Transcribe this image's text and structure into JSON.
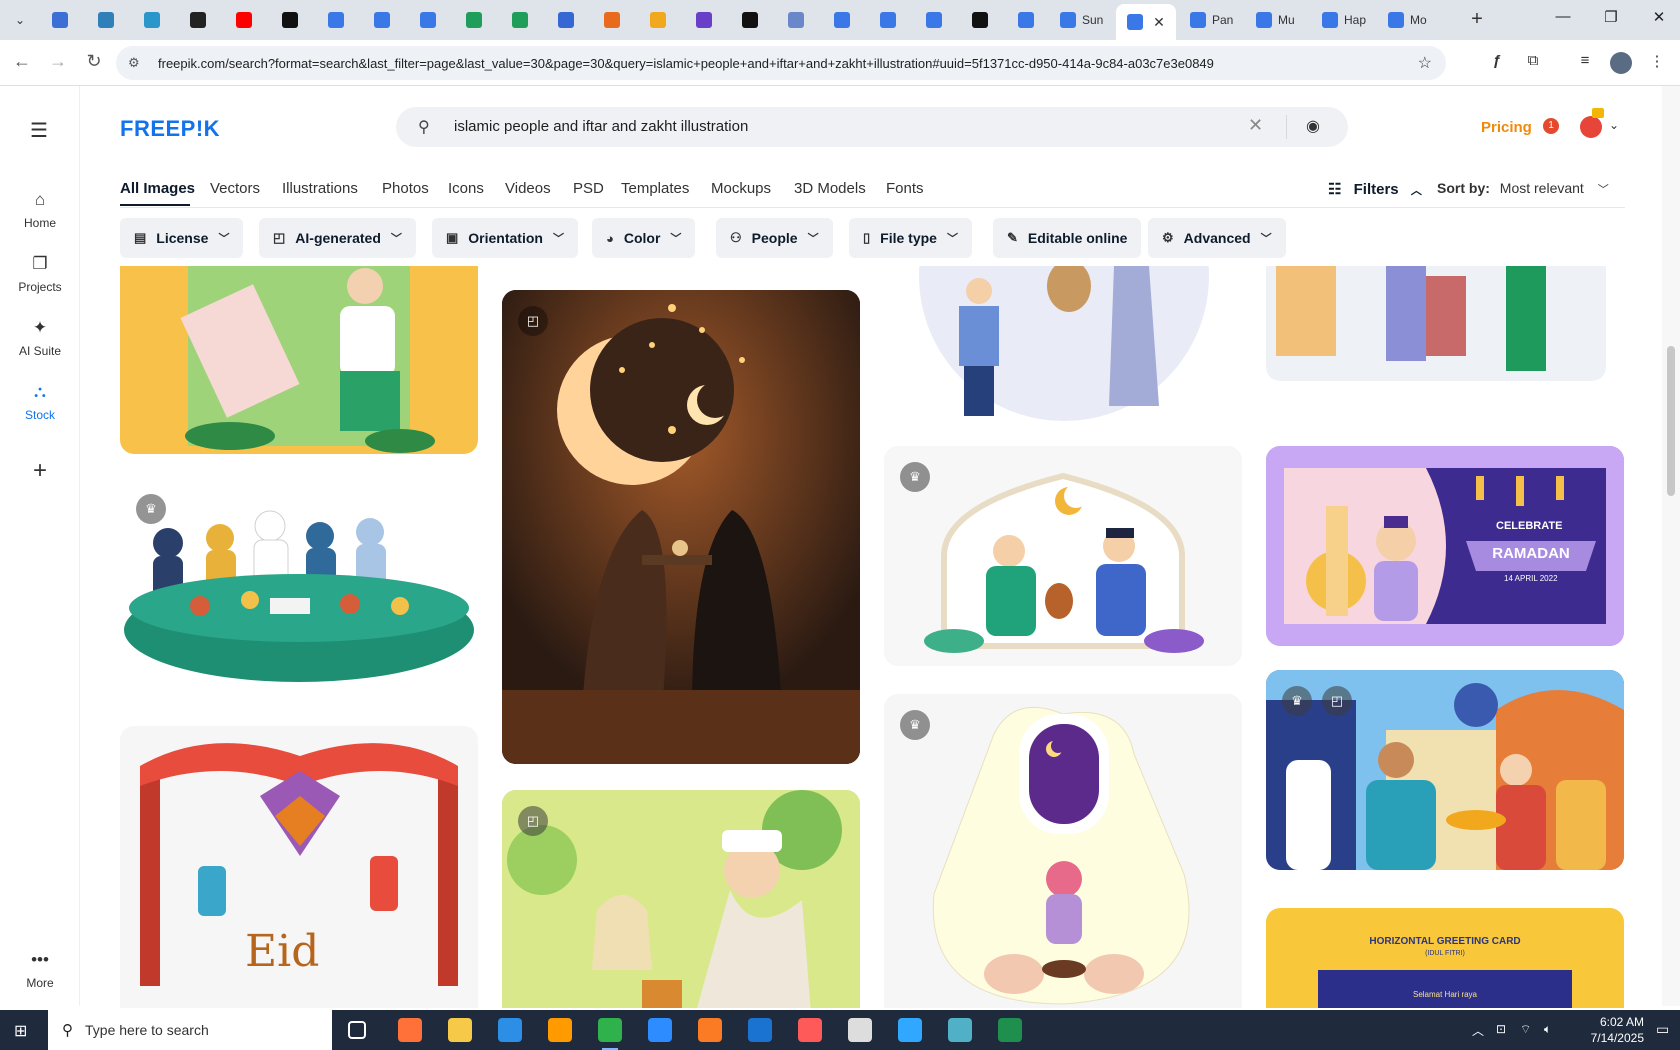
{
  "browser": {
    "tabs": [
      {
        "label": "",
        "color": "#3b6fd6"
      },
      {
        "label": "",
        "color": "#2f7fb8"
      },
      {
        "label": "",
        "color": "#2a96c9"
      },
      {
        "label": "",
        "color": "#222222"
      },
      {
        "label": "",
        "color": "#ff0000"
      },
      {
        "label": "",
        "color": "#111111"
      },
      {
        "label": "",
        "color": "#3b78e7"
      },
      {
        "label": "",
        "color": "#3b78e7"
      },
      {
        "label": "",
        "color": "#3b78e7"
      },
      {
        "label": "",
        "color": "#1e9e5a"
      },
      {
        "label": "",
        "color": "#1e9e5a"
      },
      {
        "label": "",
        "color": "#3568d4"
      },
      {
        "label": "",
        "color": "#e86a1c"
      },
      {
        "label": "",
        "color": "#f2a81d"
      },
      {
        "label": "",
        "color": "#6a3fc7"
      },
      {
        "label": "",
        "color": "#111111"
      },
      {
        "label": "",
        "color": "#6a87c9"
      },
      {
        "label": "",
        "color": "#3b78e7"
      },
      {
        "label": "",
        "color": "#3b78e7"
      },
      {
        "label": "",
        "color": "#3b78e7"
      },
      {
        "label": "",
        "color": "#111111"
      },
      {
        "label": "",
        "color": "#3b78e7"
      },
      {
        "label": "Sun",
        "color": "#3b78e7"
      },
      {
        "label": "",
        "color": "#3b78e7",
        "active": true
      },
      {
        "label": "Pan",
        "color": "#3b78e7"
      },
      {
        "label": "Mu",
        "color": "#3b78e7"
      },
      {
        "label": "Hap",
        "color": "#3b78e7"
      },
      {
        "label": "Mo",
        "color": "#3b78e7"
      }
    ],
    "url": "freepik.com/search?format=search&last_filter=page&last_value=30&page=30&query=islamic+people+and+iftar+and+zakht+illustration#uuid=5f1371cc-d950-414a-9c84-a03c7e3e0849"
  },
  "freepik": {
    "logo": "FREEP!K",
    "search_value": "islamic people and iftar and zakht illustration",
    "pricing": "Pricing",
    "notification_count": "1",
    "rail": [
      {
        "label": "Home",
        "icon": "home-icon",
        "glyph": "⌂"
      },
      {
        "label": "Projects",
        "icon": "folders-icon",
        "glyph": "❐"
      },
      {
        "label": "AI Suite",
        "icon": "sparkles-icon",
        "glyph": "✦"
      },
      {
        "label": "Stock",
        "icon": "stock-icon",
        "glyph": "⛬",
        "active": true
      }
    ],
    "more_label": "More",
    "categories": [
      "All Images",
      "Vectors",
      "Illustrations",
      "Photos",
      "Icons",
      "Videos",
      "PSD",
      "Templates",
      "Mockups",
      "3D Models",
      "Fonts"
    ],
    "active_category": "All Images",
    "filters_label": "Filters",
    "sort_label": "Sort by:",
    "sort_value": "Most relevant",
    "chips": [
      {
        "label": "License",
        "icon": "license-icon",
        "glyph": "▤"
      },
      {
        "label": "AI-generated",
        "icon": "ai-generated-icon",
        "glyph": "◰"
      },
      {
        "label": "Orientation",
        "icon": "orientation-icon",
        "glyph": "▣"
      },
      {
        "label": "Color",
        "icon": "palette-icon",
        "glyph": "◕"
      },
      {
        "label": "People",
        "icon": "people-icon",
        "glyph": "⚇"
      },
      {
        "label": "File type",
        "icon": "file-icon",
        "glyph": "▯"
      },
      {
        "label": "Editable online",
        "icon": "pencil-icon",
        "glyph": "✎"
      },
      {
        "label": "Advanced",
        "icon": "gear-icon",
        "glyph": "⚙"
      }
    ],
    "greeting_card_title": "CELEBRATE",
    "greeting_card_word": "RAMADAN",
    "greeting_card_date": "14 APRIL 2022",
    "horizontal_card_title": "HORIZONTAL GREETING CARD",
    "horizontal_card_sub": "(IDUL FITRI)",
    "horizontal_card_line": "Selamat Hari raya",
    "eid_text": "Eid"
  },
  "taskbar": {
    "search_placeholder": "Type here to search",
    "time": "6:02 AM",
    "date": "7/14/2025",
    "apps": [
      {
        "name": "task-view-icon",
        "color": "#ffffff"
      },
      {
        "name": "firefox-icon",
        "color": "#ff7139"
      },
      {
        "name": "file-explorer-icon",
        "color": "#f7c948"
      },
      {
        "name": "vscode-icon",
        "color": "#2d8ee6"
      },
      {
        "name": "illustrator-icon",
        "color": "#ff9a00"
      },
      {
        "name": "chrome-icon",
        "color": "#2fb24c"
      },
      {
        "name": "zoom-icon",
        "color": "#2d8cff"
      },
      {
        "name": "xampp-icon",
        "color": "#fb7a24"
      },
      {
        "name": "outlook-icon",
        "color": "#1a73d1"
      },
      {
        "name": "creative-cloud-icon",
        "color": "#ff5a5a"
      },
      {
        "name": "inkscape-icon",
        "color": "#dddddd"
      },
      {
        "name": "photoshop-icon",
        "color": "#31a8ff"
      },
      {
        "name": "app-gem-icon",
        "color": "#4fb0c6"
      },
      {
        "name": "excel-icon",
        "color": "#1f8f4e"
      }
    ]
  }
}
